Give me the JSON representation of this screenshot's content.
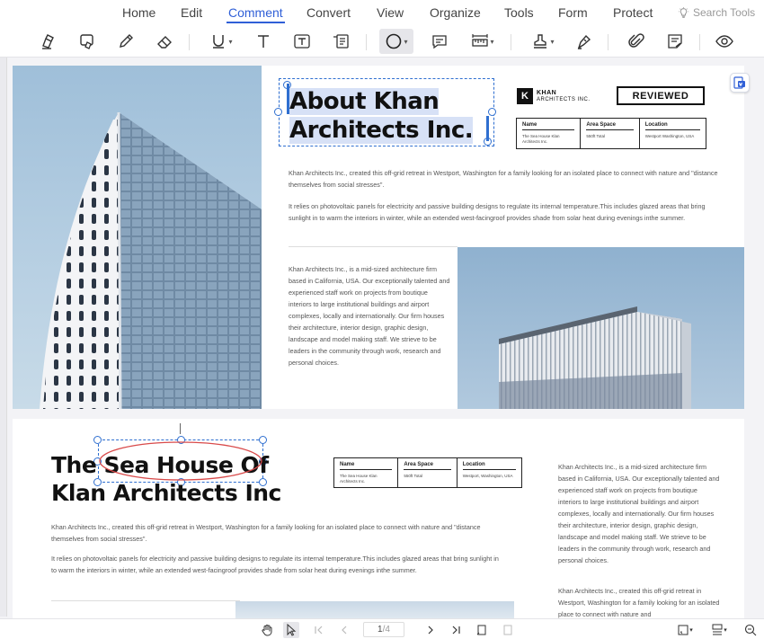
{
  "menu": {
    "items": [
      "Home",
      "Edit",
      "Comment",
      "Convert",
      "View",
      "Organize",
      "Tools",
      "Form",
      "Protect"
    ],
    "active": "Comment",
    "search_placeholder": "Search Tools"
  },
  "toolbar": {
    "icons": [
      "highlight-icon",
      "area-highlight-icon",
      "pencil-icon",
      "eraser-icon",
      "underline-icon",
      "text-icon",
      "textbox-icon",
      "callout-icon",
      "ellipse-icon",
      "note-icon",
      "measure-icon",
      "stamp-icon",
      "signature-icon",
      "attachment-icon",
      "sticky-note-icon",
      "eye-icon"
    ],
    "active_tool": "ellipse-icon"
  },
  "page1": {
    "title_line1": "About Khan",
    "title_line2": "Architects Inc.",
    "logo_mark": "K",
    "logo_line1": "KHAN",
    "logo_line2": "ARCHITECTS INC.",
    "stamp": "REVIEWED",
    "table": {
      "headers": [
        "Name",
        "Area Space",
        "Location"
      ],
      "values": [
        "The Sea House Klan Architects Inc.",
        "550ft Total",
        "Westport Washington, USA"
      ]
    },
    "para1": "Khan Architects Inc., created this off-grid retreat in Westport, Washington for a family looking for an isolated place to connect with nature and \"distance themselves from social stresses\".",
    "para2": "It relies on photovoltaic panels for electricity and passive building designs to regulate its internal temperature.This includes glazed areas that bring sunlight in to warm the interiors in winter, while an extended west-facingroof provides shade from solar heat during evenings inthe summer.",
    "para3": "Khan Architects Inc., is a mid-sized architecture firm based in California, USA. Our exceptionally talented and experienced staff work on projects from boutique interiors to large institutional buildings and airport complexes, locally and internationally. Our firm houses their architecture, interior design, graphic design, landscape and model making staff. We strieve to be leaders in the community through work, research and personal choices."
  },
  "page2": {
    "title_line1": "The Sea House Of",
    "title_line2": "Klan Architects Inc",
    "table": {
      "headers": [
        "Name",
        "Area Space",
        "Location"
      ],
      "values": [
        "The Sea House Klan Architects Inc.",
        "550ft Total",
        "Westport, Washington, USA"
      ]
    },
    "para1": "Khan Architects Inc., created this off-grid retreat in Westport, Washington for a family looking for an isolated place to connect with nature and \"distance themselves from social stresses\".",
    "para2": "It relies on photovoltaic panels for electricity and passive building designs to regulate its internal temperature.This includes glazed areas that bring sunlight in to warm the interiors in winter, while an extended west-facingroof provides shade from solar heat during evenings inthe summer.",
    "side1": "Khan Architects Inc., is a mid-sized architecture firm based in California, USA. Our exceptionally talented and experienced staff work on projects from boutique interiors to large institutional buildings and airport complexes, locally and internationally. Our firm houses their architecture, interior design, graphic design, landscape and model making staff. We strieve to be leaders in the community through work, research and personal choices.",
    "side2": "Khan Architects Inc., created this off-grid retreat in Westport, Washington for a family looking for an isolated place to connect with nature and"
  },
  "statusbar": {
    "current_page": "1",
    "total_pages": "/4"
  },
  "colors": {
    "accent": "#2f5fd7",
    "ellipse_annotation": "#d94a4a",
    "selection": "#2f6fd0"
  }
}
